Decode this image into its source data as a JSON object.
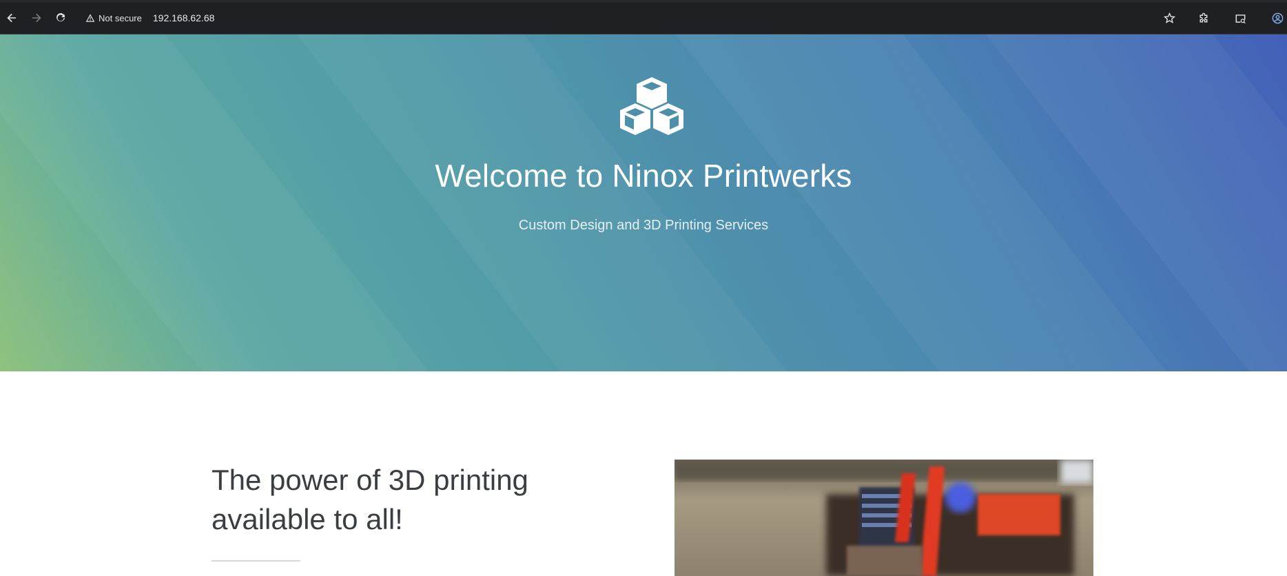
{
  "browser": {
    "security_label": "Not secure",
    "url": "192.168.62.68",
    "icons": {
      "back": "arrow-left-icon",
      "forward": "arrow-right-icon",
      "reload": "reload-icon",
      "warning": "warning-triangle-icon",
      "bookmark": "star-icon",
      "extensions": "puzzle-icon",
      "tab_search": "tab-search-icon",
      "profile": "profile-icon"
    }
  },
  "hero": {
    "title_prefix": "Welcome to ",
    "title_brand": "Ninox Printwerks",
    "subtitle": "Custom Design and 3D Printing Services",
    "logo_icon": "cubes-icon"
  },
  "content": {
    "heading": "The power of 3D printing available to all!",
    "image_icon": "3d-printer-nozzle-photo"
  }
}
